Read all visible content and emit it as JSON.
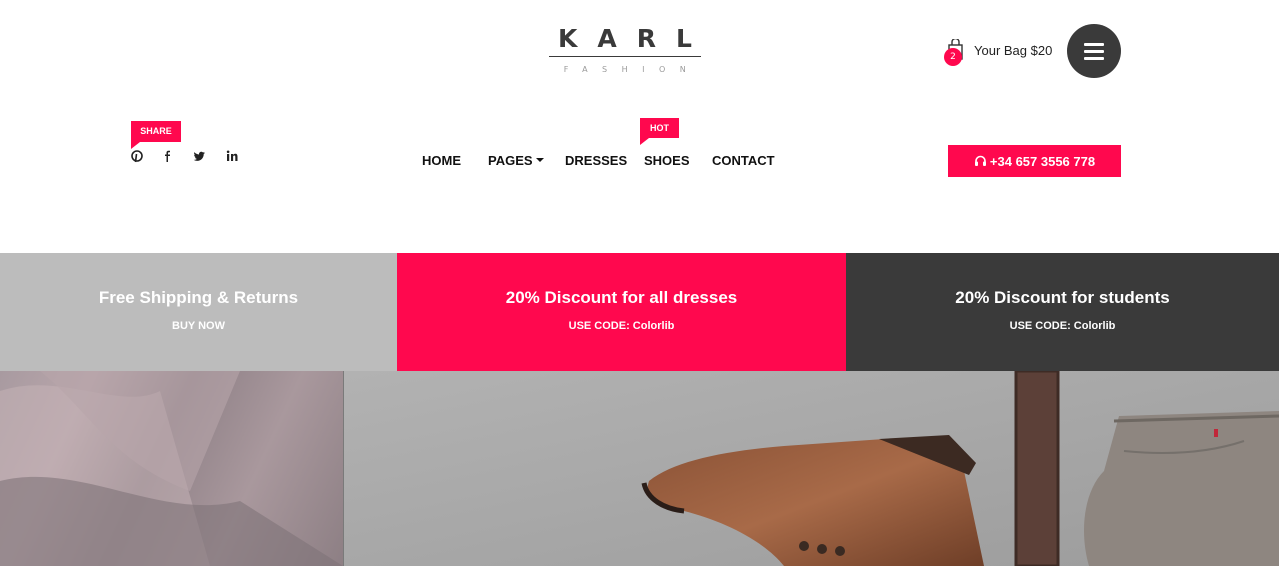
{
  "logo": {
    "main": "KARL",
    "sub": "FASHION"
  },
  "header": {
    "bag_count": "2",
    "bag_label": "Your Bag $20"
  },
  "share": {
    "tag": "SHARE",
    "icons": [
      "pinterest-icon",
      "facebook-icon",
      "twitter-icon",
      "linkedin-icon"
    ]
  },
  "nav": {
    "hot_tag": "HOT",
    "items": [
      {
        "label": "HOME"
      },
      {
        "label": "PAGES"
      },
      {
        "label": "DRESSES"
      },
      {
        "label": "SHOES"
      },
      {
        "label": "CONTACT"
      }
    ]
  },
  "phone": {
    "label": "+34 657 3556 778"
  },
  "promos": [
    {
      "title": "Free Shipping & Returns",
      "sub": "BUY NOW",
      "color": "#bcbcbc"
    },
    {
      "title": "20% Discount for all dresses",
      "sub": "USE CODE: Colorlib",
      "color": "#ff084e"
    },
    {
      "title": "20% Discount for students",
      "sub": "USE CODE: Colorlib",
      "color": "#3a3a3a"
    }
  ],
  "colors": {
    "accent": "#ff084e",
    "dark": "#3a3a3a",
    "gray": "#bcbcbc"
  }
}
